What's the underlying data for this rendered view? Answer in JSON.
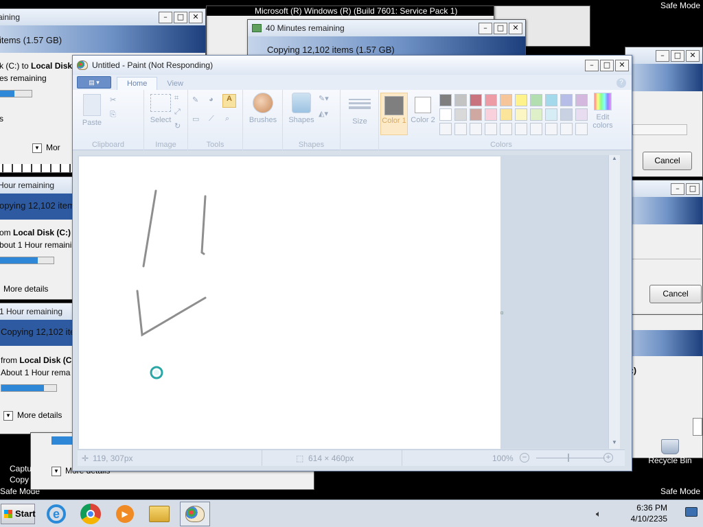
{
  "desktop": {
    "safe_mode_label": "Safe Mode",
    "build_text": "Microsoft (R) Windows (R) (Build 7601: Service Pack 1)",
    "recycle_bin_label": "Recycle Bin",
    "capture_label_1": "Captu",
    "capture_label_2": "Copy"
  },
  "dialog_a": {
    "title": "aining",
    "items": "items (1.57 GB)",
    "from_prefix": "k (C:) to ",
    "from_bold": "Local Disk (",
    "remaining": "es remaining",
    "s": "s",
    "more": "Mor",
    "progress": 0.46
  },
  "dialog_b": {
    "title": "40 Minutes remaining",
    "copying": "Copying 12,102 items (1.57 GB)"
  },
  "dialog_c": {
    "title": "Hour remaining",
    "copying": "opying 12,102 items",
    "from_prefix": "om ",
    "from_bold": "Local Disk (C:)",
    "from_suffix": " t",
    "about": "bout 1 Hour remaini",
    "more_details": "More details",
    "progress": 0.7
  },
  "dialog_d": {
    "title": "1 Hour remaining",
    "copying": "Copying 12,102 iter",
    "from_prefix": "from ",
    "from_bold": "Local Disk (C:",
    "about": "About 1 Hour rema",
    "more_details": "More details",
    "progress": 0.78
  },
  "dialog_e": {
    "more_details": "More details"
  },
  "dialog_right1": {
    "cancel": "Cancel"
  },
  "dialog_right2": {
    "cancel": "Cancel",
    "fragment": ":)"
  },
  "paint": {
    "title": "Untitled - Paint (Not Responding)",
    "tabs": [
      "Home",
      "View"
    ],
    "groups": {
      "clipboard": "Clipboard",
      "image": "Image",
      "tools": "Tools",
      "shapes": "Shapes",
      "colors": "Colors"
    },
    "tools": {
      "paste": "Paste",
      "select": "Select",
      "brushes": "Brushes",
      "shapes": "Shapes",
      "size": "Size",
      "color1": "Color 1",
      "color2": "Color 2",
      "edit_colors": "Edit colors"
    },
    "palette_row1": [
      "#7f7f7f",
      "#c3c3c3",
      "#c8737e",
      "#ed9ca5",
      "#f7c59a",
      "#fdf28b",
      "#b3deb0",
      "#a3d9ea",
      "#b6bde6",
      "#d4b8dd"
    ],
    "palette_row2": [
      "#ffffff",
      "#d9d9d9",
      "#cfa8a2",
      "#f8d1dc",
      "#fbe59b",
      "#fbf6c3",
      "#def0c7",
      "#d7edf6",
      "#c9d2e2",
      "#e7dcf0"
    ],
    "color1_hex": "#7f7f7f",
    "color2_hex": "#ffffff",
    "status": {
      "cursor_pos": "119, 307px",
      "canvas_size": "614 × 460px",
      "zoom": "100%"
    }
  },
  "taskbar": {
    "start_label": "Start",
    "time": "6:36 PM",
    "date": "4/10/2235"
  }
}
